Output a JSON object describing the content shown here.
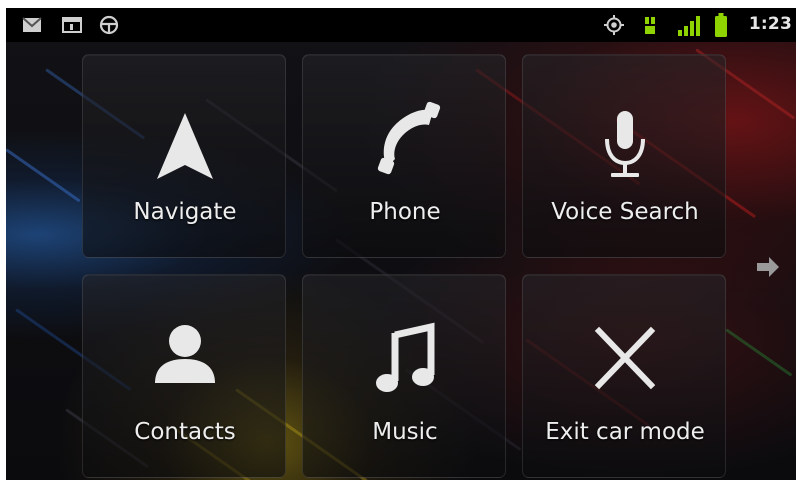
{
  "status_bar": {
    "notification_icons": [
      "gmail-icon",
      "calendar-icon",
      "car-mode-icon"
    ],
    "system_icons": [
      "gps-icon",
      "data-3g-icon",
      "signal-icon",
      "battery-icon"
    ],
    "time": "1:23"
  },
  "car_home": {
    "tiles": [
      {
        "label": "Navigate",
        "icon": "navigate-arrow-icon"
      },
      {
        "label": "Phone",
        "icon": "phone-handset-icon"
      },
      {
        "label": "Voice Search",
        "icon": "microphone-icon"
      },
      {
        "label": "Contacts",
        "icon": "person-icon"
      },
      {
        "label": "Music",
        "icon": "music-note-icon"
      },
      {
        "label": "Exit car mode",
        "icon": "close-x-icon"
      }
    ],
    "next_page_icon": "arrow-right-icon"
  },
  "colors": {
    "accent_green": "#8fd400",
    "status_bar": "#000000",
    "icon_light": "#e8e8e8"
  }
}
